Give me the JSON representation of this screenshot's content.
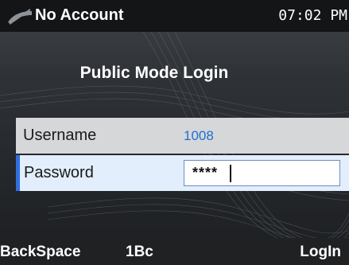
{
  "status_bar": {
    "account_icon": "handset-icon",
    "account_text": "No Account",
    "time": "07:02 PM"
  },
  "page": {
    "title": "Public Mode Login"
  },
  "form": {
    "username": {
      "label": "Username",
      "value": "1008"
    },
    "password": {
      "label": "Password",
      "value": "****"
    }
  },
  "softkeys": {
    "backspace": "BackSpace",
    "input_mode": "1Bc",
    "login": "LogIn"
  },
  "colors": {
    "accent": "#2f6fe0",
    "value_text": "#1f6fd1",
    "background": "#2f3337"
  }
}
